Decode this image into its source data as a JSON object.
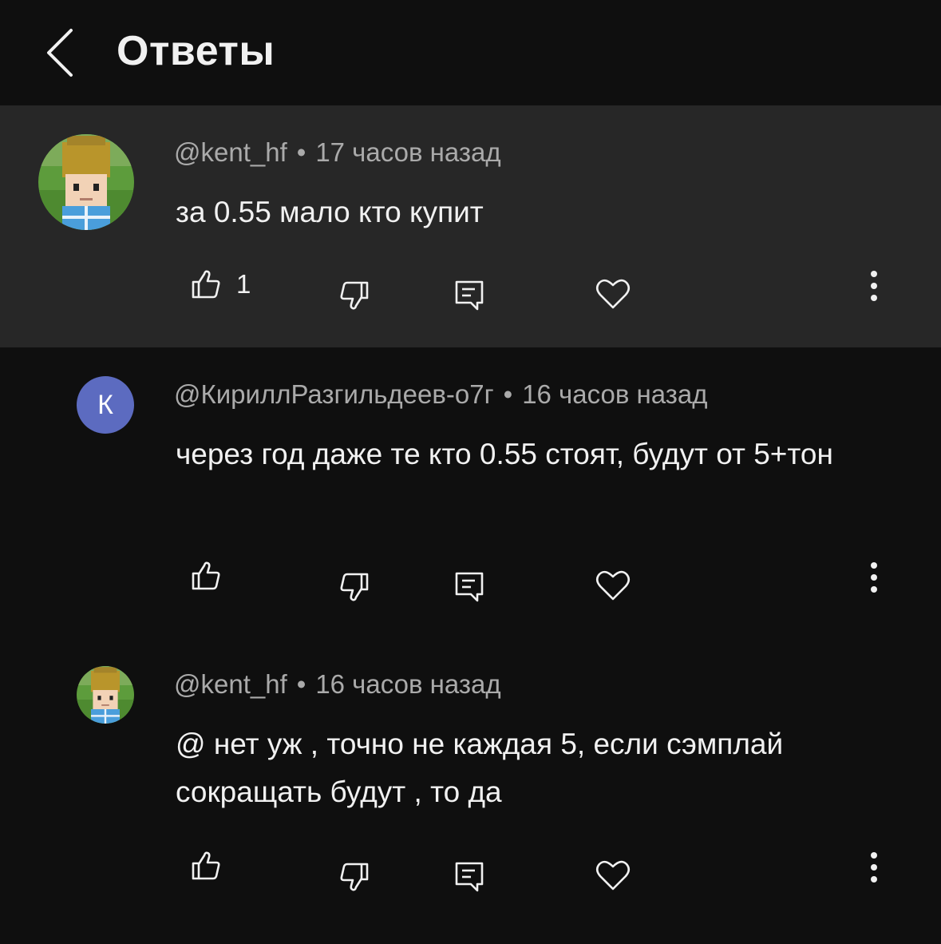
{
  "header": {
    "title": "Ответы",
    "back_icon": "chevron-left-icon"
  },
  "colors": {
    "background": "#0f0f0f",
    "highlight": "#272727",
    "secondary_text": "#aaaaaa",
    "avatar_letter_bg": "#5c6bc0"
  },
  "comments": [
    {
      "author": "@kent_hf",
      "separator": "•",
      "time": "17 часов назад",
      "text": "за 0.55 мало кто купит",
      "likes": "1",
      "avatar": "minecraft-avatar"
    },
    {
      "author": "@КириллРазгильдеев-о7г",
      "separator": "•",
      "time": "16 часов назад",
      "text": "через год даже те кто 0.55 стоят, будут от 5+тон",
      "likes": "",
      "avatar_letter": "К"
    },
    {
      "author": "@kent_hf",
      "separator": "•",
      "time": "16 часов назад",
      "text": "@ нет уж , точно не каждая 5, если сэмплай сокращать будут , то да",
      "likes": "",
      "avatar": "minecraft-avatar"
    }
  ]
}
